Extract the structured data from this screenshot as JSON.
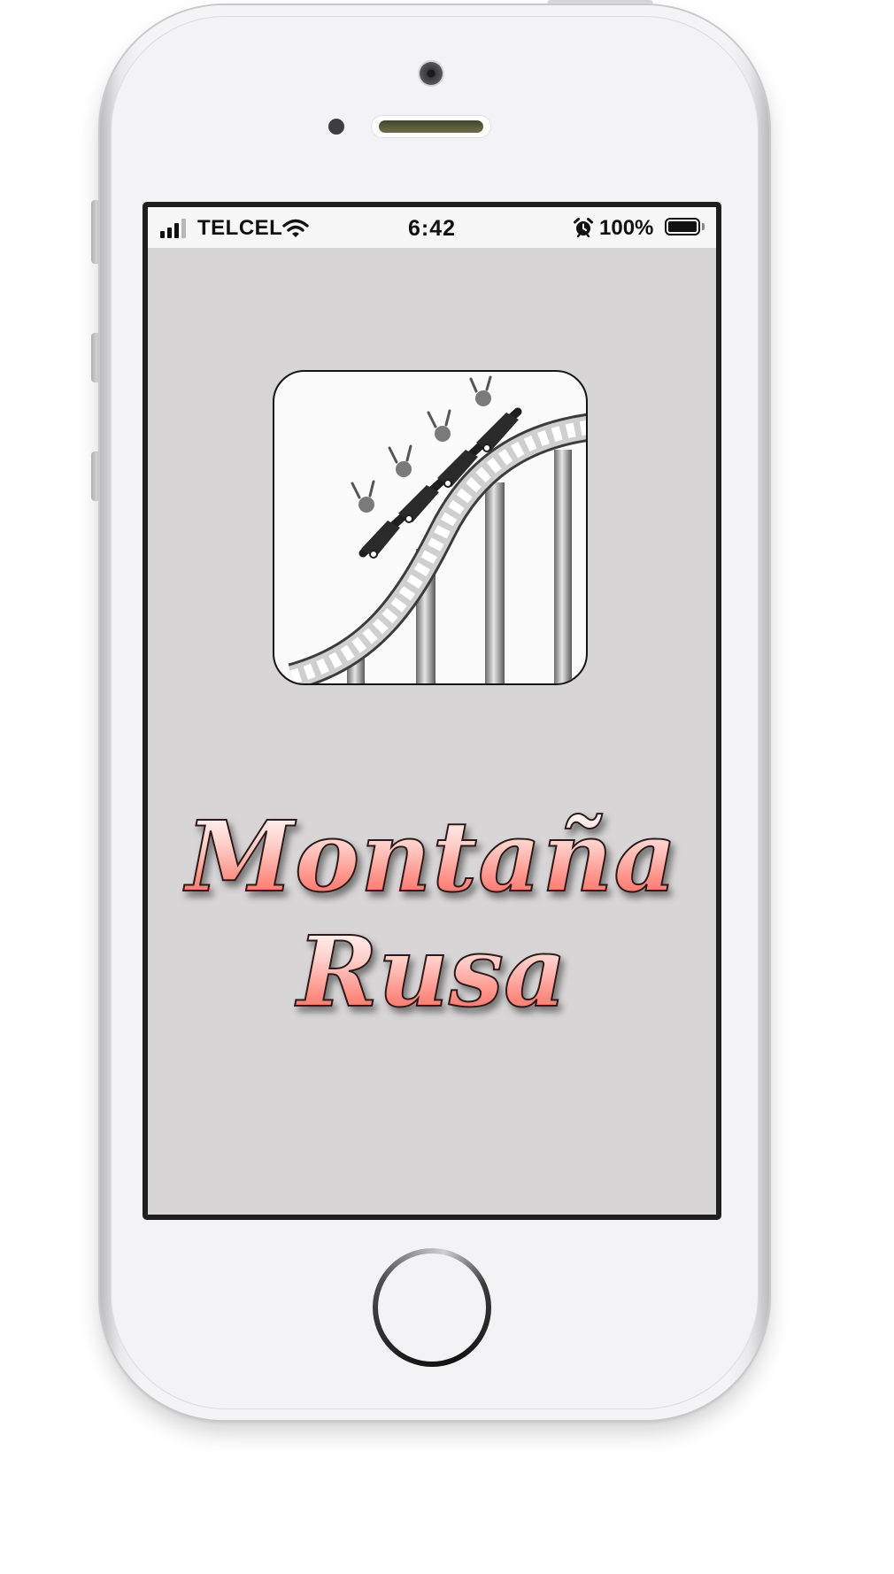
{
  "device": {
    "model": "iPhone",
    "colors": {
      "body": "#f3f3f6",
      "screen_background": "#d7d5d6",
      "title_accent": "#ff7a70"
    }
  },
  "status_bar": {
    "carrier": "TELCEL",
    "time": "6:42",
    "battery_percent": "100%",
    "battery_level": 1.0,
    "icons": [
      "signal-icon",
      "wifi-icon",
      "alarm-icon",
      "battery-icon"
    ]
  },
  "app": {
    "icon": "roller-coaster-icon",
    "title_line1": "Montaña",
    "title_line2": "Rusa"
  }
}
